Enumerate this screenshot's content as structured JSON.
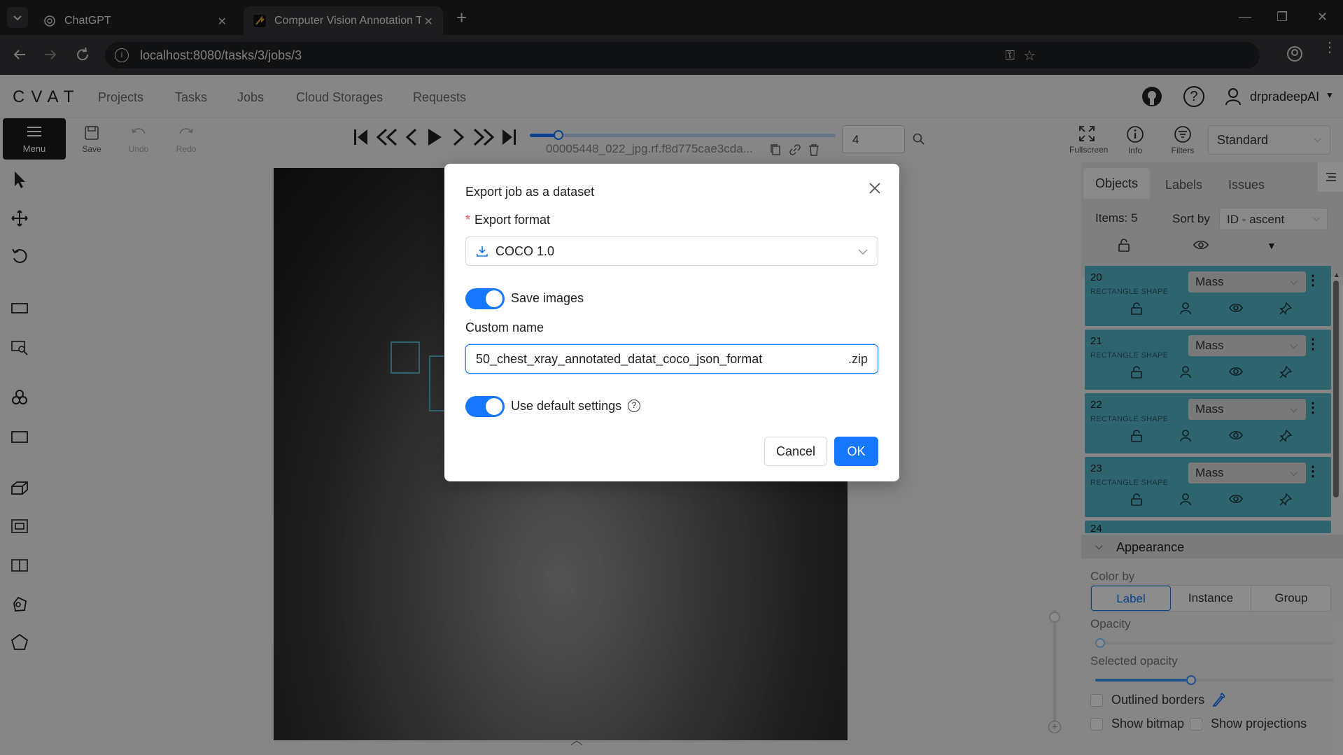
{
  "browser": {
    "tabs": [
      {
        "label": "ChatGPT",
        "active": false
      },
      {
        "label": "Computer Vision Annotation To",
        "active": true
      }
    ],
    "url": "localhost:8080/tasks/3/jobs/3"
  },
  "app": {
    "logo": "CVAT",
    "nav": [
      "Projects",
      "Tasks",
      "Jobs",
      "Cloud Storages",
      "Requests"
    ],
    "user": "drpradeepAI"
  },
  "toolbar": {
    "menu_label": "Menu",
    "save_label": "Save",
    "undo_label": "Undo",
    "redo_label": "Redo",
    "filename": "00005448_022_jpg.rf.f8d775cae3cda...",
    "frame_number": "4",
    "frame_progress": 0.08,
    "fullscreen_label": "Fullscreen",
    "info_label": "Info",
    "filters_label": "Filters",
    "workspace": "Standard"
  },
  "objects_panel": {
    "tabs": [
      "Objects",
      "Labels",
      "Issues"
    ],
    "items_count": "Items: 5",
    "sort_label": "Sort by",
    "sort_value": "ID - ascent",
    "objects": [
      {
        "id": "20",
        "type": "RECTANGLE SHAPE",
        "label": "Mass"
      },
      {
        "id": "21",
        "type": "RECTANGLE SHAPE",
        "label": "Mass"
      },
      {
        "id": "22",
        "type": "RECTANGLE SHAPE",
        "label": "Mass"
      },
      {
        "id": "23",
        "type": "RECTANGLE SHAPE",
        "label": "Mass"
      },
      {
        "id": "24",
        "type": "",
        "label": ""
      }
    ],
    "object_color": "#53b6c8"
  },
  "appearance": {
    "title": "Appearance",
    "color_by_label": "Color by",
    "color_by_options": [
      "Label",
      "Instance",
      "Group"
    ],
    "color_by_selected": "Label",
    "opacity_label": "Opacity",
    "opacity_value": 0.0,
    "selected_opacity_label": "Selected opacity",
    "selected_opacity_value": 0.4,
    "outlined_borders": "Outlined borders",
    "show_bitmap": "Show bitmap",
    "show_projections": "Show projections"
  },
  "modal": {
    "title": "Export job as a dataset",
    "format_label": "Export format",
    "format_value": "COCO 1.0",
    "save_images_label": "Save images",
    "save_images_on": true,
    "custom_name_label": "Custom name",
    "custom_name_value": "50_chest_xray_annotated_datat_coco_json_format",
    "custom_name_suffix": ".zip",
    "default_settings_label": "Use default settings",
    "default_settings_on": true,
    "cancel_label": "Cancel",
    "ok_label": "OK",
    "accent": "#1677ff"
  }
}
